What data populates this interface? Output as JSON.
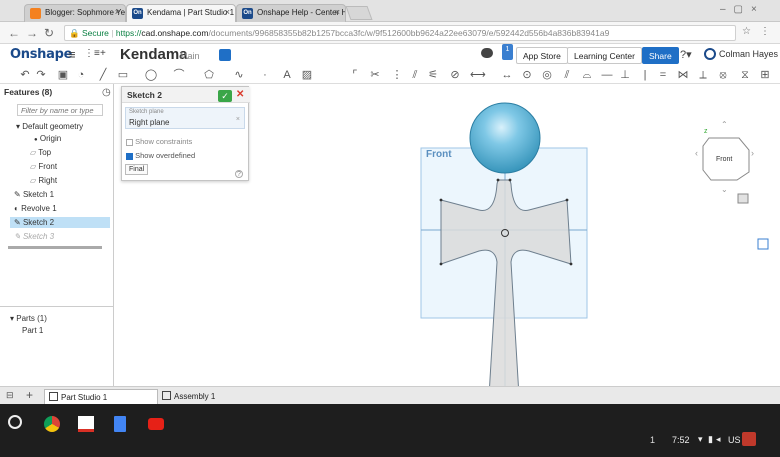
{
  "browser": {
    "tabs": [
      {
        "label": "Blogger: Sophmore Yea",
        "color": "#f4811f"
      },
      {
        "label": "Kendama | Part Studio 1",
        "color": "#1b4a8a"
      },
      {
        "label": "Onshape Help - Center H",
        "color": "#1b4a8a"
      }
    ],
    "secure_label": "Secure",
    "url_scheme": "https://",
    "url_host": "cad.onshape.com",
    "url_path": "/documents/996858355b82b1257bcca3fc/w/9f512600bb9624a22ee63079/e/592442d556b4a836b83941a9"
  },
  "app": {
    "logo": "Onshape",
    "doc_title": "Kendama",
    "branch": "Main",
    "app_store": "App Store",
    "learning_center": "Learning Center",
    "share": "Share",
    "user": "Colman Hayes",
    "notif_count": "1",
    "accent": "#1f6fc6"
  },
  "features": {
    "header": "Features (8)",
    "filter_placeholder": "Filter by name or type",
    "default_geometry": "Default geometry",
    "origin": "Origin",
    "top": "Top",
    "front": "Front",
    "right": "Right",
    "sketch1": "Sketch 1",
    "revolve1": "Revolve 1",
    "sketch2": "Sketch 2",
    "sketch3": "Sketch 3",
    "parts_header": "Parts (1)",
    "part1": "Part 1"
  },
  "sketch_dialog": {
    "title": "Sketch 2",
    "plane_label": "Sketch plane",
    "plane_value": "Right plane",
    "show_constraints": "Show constraints",
    "show_overdefined": "Show overdefined",
    "final": "Final"
  },
  "viewport": {
    "plane_label": "Front",
    "viewcube_label": "Front"
  },
  "bottom": {
    "tab1": "Part Studio 1",
    "tab2": "Assembly 1"
  },
  "taskbar": {
    "page": "1",
    "time": "7:52",
    "locale": "US"
  }
}
